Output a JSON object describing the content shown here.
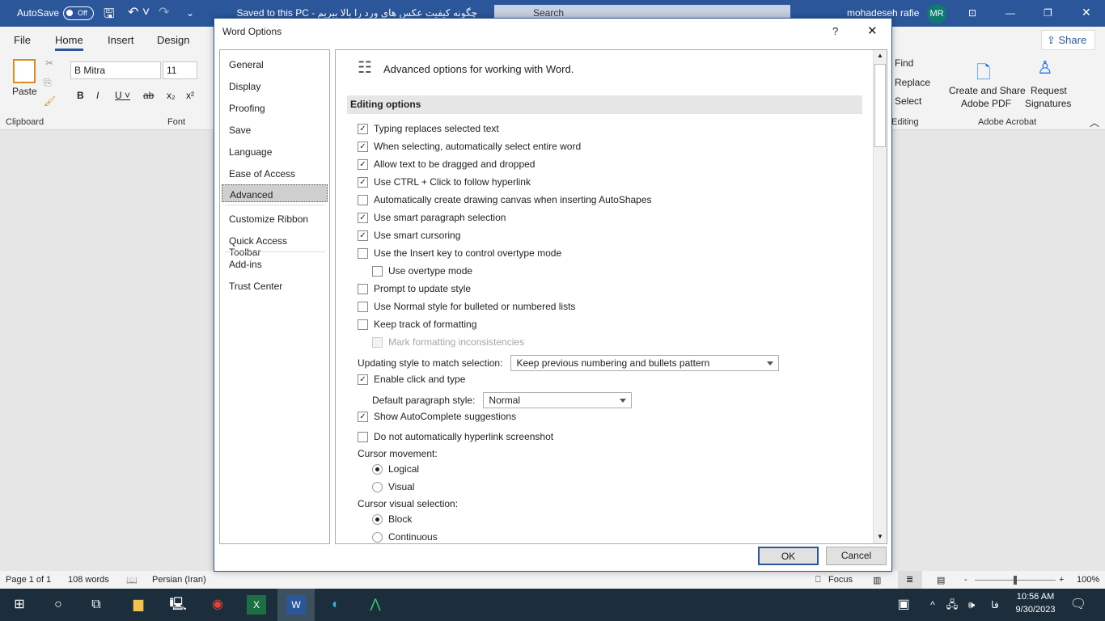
{
  "titlebar": {
    "autosave": "AutoSave",
    "toggle": "Off",
    "doc_title": "چگونه کیفیت عکس های ورد را بالا ببریم  -  Saved to this PC",
    "search": "Search",
    "user": "mohadeseh rafie",
    "initials": "MR"
  },
  "ribbon": {
    "tabs": [
      "File",
      "Home",
      "Insert",
      "Design"
    ],
    "share": "Share",
    "paste": "Paste",
    "font_name": "B Mitra",
    "font_size": "11",
    "clipboard": "Clipboard",
    "font": "Font",
    "find": "Find",
    "replace": "Replace",
    "select": "Select",
    "editing": "Editing",
    "create_pdf_1": "Create and Share",
    "create_pdf_2": "Adobe PDF",
    "request_1": "Request",
    "request_2": "Signatures",
    "adobe": "Adobe Acrobat",
    "accent": "#2b579a"
  },
  "dialog": {
    "title": "Word Options",
    "help": "?",
    "ok": "OK",
    "cancel": "Cancel",
    "nav": [
      "General",
      "Display",
      "Proofing",
      "Save",
      "Language",
      "Ease of Access",
      "Advanced",
      "Customize Ribbon",
      "Quick Access Toolbar",
      "Add-ins",
      "Trust Center"
    ],
    "selected_nav": "Advanced",
    "header": "Advanced options for working with Word.",
    "section": "Editing options",
    "options": [
      {
        "label": "Typing replaces selected text",
        "checked": true
      },
      {
        "label": "When selecting, automatically select entire word",
        "checked": true
      },
      {
        "label": "Allow text to be dragged and dropped",
        "checked": true
      },
      {
        "label": "Use CTRL + Click to follow hyperlink",
        "checked": true
      },
      {
        "label": "Automatically create drawing canvas when inserting AutoShapes",
        "checked": false
      },
      {
        "label": "Use smart paragraph selection",
        "checked": true
      },
      {
        "label": "Use smart cursoring",
        "checked": true
      },
      {
        "label": "Use the Insert key to control overtype mode",
        "checked": false
      },
      {
        "label": "Use overtype mode",
        "checked": false,
        "indent": true
      },
      {
        "label": "Prompt to update style",
        "checked": false
      },
      {
        "label": "Use Normal style for bulleted or numbered lists",
        "checked": false
      },
      {
        "label": "Keep track of formatting",
        "checked": false
      },
      {
        "label": "Mark formatting inconsistencies",
        "checked": false,
        "indent": true,
        "disabled": true
      }
    ],
    "updating_label": "Updating style to match selection:",
    "updating_value": "Keep previous numbering and bullets pattern",
    "click_type": {
      "label": "Enable click and type",
      "checked": true
    },
    "default_style_label": "Default paragraph style:",
    "default_style_value": "Normal",
    "autocomplete": {
      "label": "Show AutoComplete suggestions",
      "checked": true
    },
    "hyperlink_ss": {
      "label": "Do not automatically hyperlink screenshot",
      "checked": false
    },
    "cursor_movement": "Cursor movement:",
    "cm_options": [
      {
        "label": "Logical",
        "selected": true
      },
      {
        "label": "Visual",
        "selected": false
      }
    ],
    "cursor_visual": "Cursor visual selection:",
    "cv_options": [
      {
        "label": "Block",
        "selected": true
      },
      {
        "label": "Continuous",
        "selected": false
      }
    ]
  },
  "status": {
    "page": "Page 1 of 1",
    "words": "108 words",
    "language": "Persian (Iran)",
    "focus": "Focus",
    "zoom": "100%",
    "zoom_level": 100
  },
  "taskbar": {
    "time": "10:56 AM",
    "date": "9/30/2023",
    "ime": "فا"
  }
}
